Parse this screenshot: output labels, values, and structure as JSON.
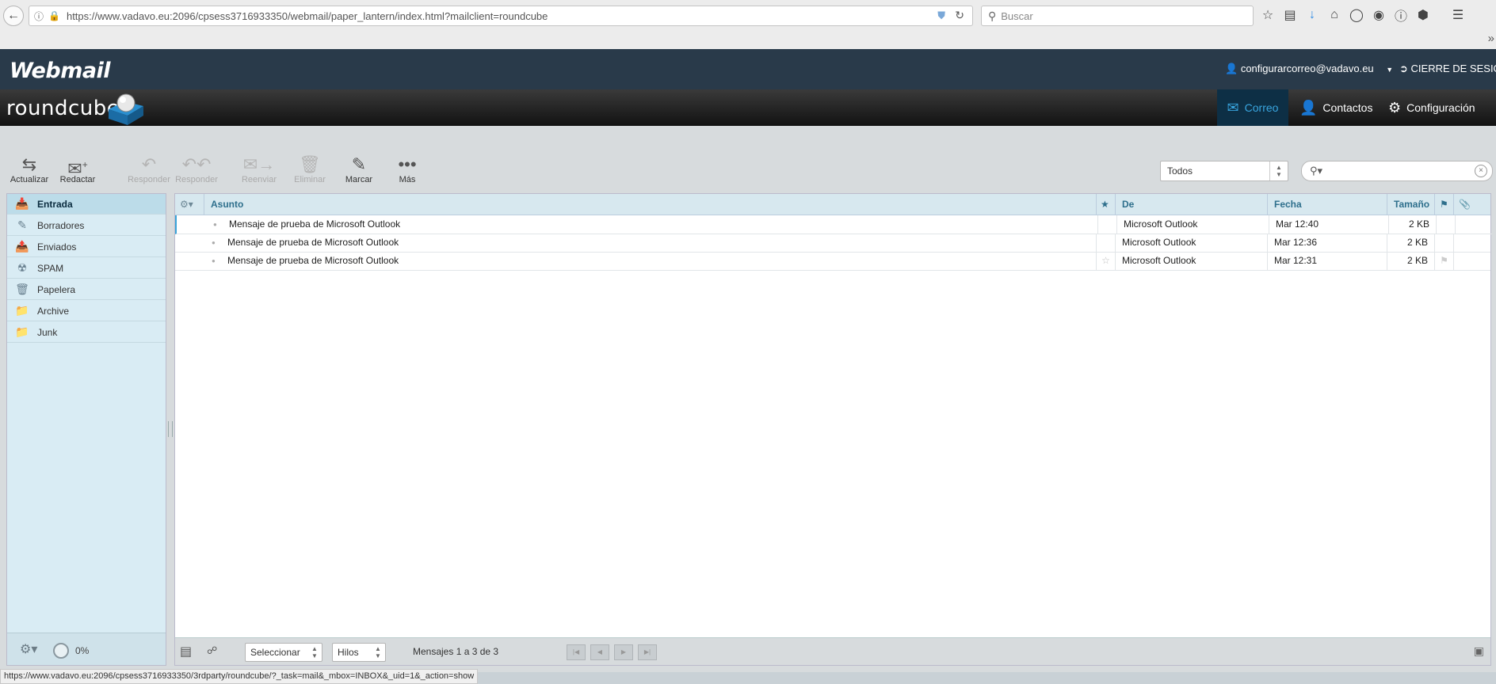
{
  "browser": {
    "url": "https://www.vadavo.eu:2096/cpsess3716933350/webmail/paper_lantern/index.html?mailclient=roundcube",
    "search_placeholder": "Buscar",
    "status_url": "https://www.vadavo.eu:2096/cpsess3716933350/3rdparty/roundcube/?_task=mail&_mbox=INBOX&_uid=1&_action=show"
  },
  "cpanel": {
    "logo": "Webmail",
    "user": "configurarcorreo@vadavo.eu",
    "logout": "CIERRE DE SESIÓN"
  },
  "roundcube": {
    "logo": "roundcube",
    "nav": {
      "mail": "Correo",
      "contacts": "Contactos",
      "settings": "Configuración"
    }
  },
  "toolbar": {
    "refresh": "Actualizar",
    "compose": "Redactar",
    "reply": "Responder",
    "reply_all": "Responder",
    "forward": "Reenviar",
    "delete": "Eliminar",
    "mark": "Marcar",
    "more": "Más"
  },
  "filter": {
    "selected": "Todos"
  },
  "folders": [
    {
      "label": "Entrada",
      "icon": "inbox-icon"
    },
    {
      "label": "Borradores",
      "icon": "pencil-icon"
    },
    {
      "label": "Enviados",
      "icon": "sent-icon"
    },
    {
      "label": "SPAM",
      "icon": "spam-icon"
    },
    {
      "label": "Papelera",
      "icon": "trash-icon"
    },
    {
      "label": "Archive",
      "icon": "folder-icon"
    },
    {
      "label": "Junk",
      "icon": "folder-icon"
    }
  ],
  "quota": "0%",
  "columns": {
    "subject": "Asunto",
    "from": "De",
    "date": "Fecha",
    "size": "Tamaño"
  },
  "messages": [
    {
      "subject": "Mensaje de prueba de Microsoft Outlook",
      "from": "Microsoft Outlook",
      "date": "Mar 12:40",
      "size": "2 KB"
    },
    {
      "subject": "Mensaje de prueba de Microsoft Outlook",
      "from": "Microsoft Outlook",
      "date": "Mar 12:36",
      "size": "2 KB"
    },
    {
      "subject": "Mensaje de prueba de Microsoft Outlook",
      "from": "Microsoft Outlook",
      "date": "Mar 12:31",
      "size": "2 KB"
    }
  ],
  "list_footer": {
    "select": "Seleccionar",
    "threads": "Hilos",
    "count": "Mensajes 1 a 3 de 3"
  },
  "colors": {
    "header_bg": "#293a4a",
    "accent": "#39a6e0",
    "folder_bg": "#d9ecf4"
  }
}
